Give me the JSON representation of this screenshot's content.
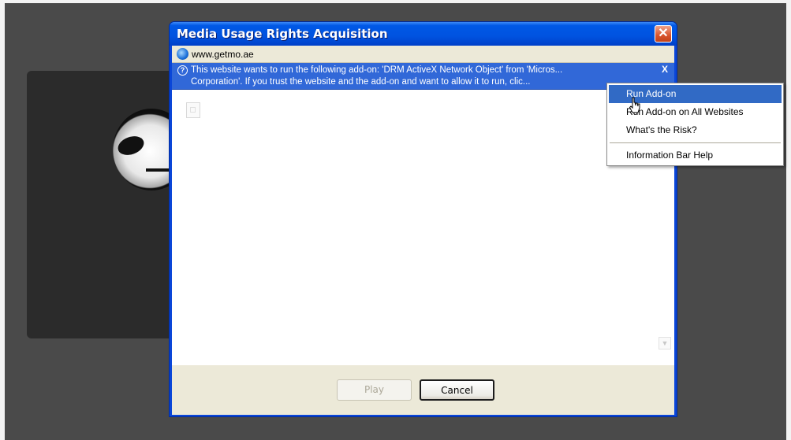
{
  "dialog": {
    "title": "Media Usage Rights Acquisition",
    "address": "www.getmo.ae",
    "infobar_line1": "This website wants to run the following add-on: 'DRM ActiveX Network Object' from 'Micros...",
    "infobar_line2": "Corporation'. If you trust the website and the add-on and want to allow it to run, clic...",
    "info_icon": "?",
    "infobar_close": "X",
    "close_glyph": "✕"
  },
  "buttons": {
    "play": "Play",
    "cancel": "Cancel"
  },
  "context_menu": {
    "items": [
      {
        "label": "Run Add-on",
        "highlighted": true
      },
      {
        "label": "Run Add-on on All Websites"
      },
      {
        "label": "What's the Risk?"
      },
      {
        "label": "Information Bar Help"
      }
    ]
  },
  "colors": {
    "titlebar": "#0053e0",
    "infobar": "#3168d8",
    "menu_highlight": "#316ac5",
    "dialog_face": "#ece9d8",
    "close_button": "#d8542d"
  }
}
